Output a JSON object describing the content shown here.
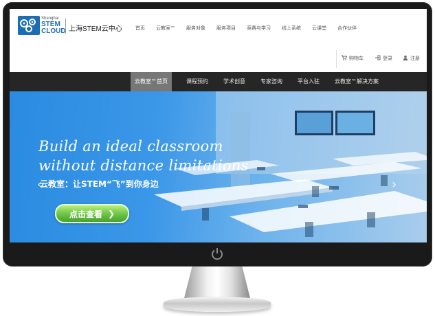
{
  "logo": {
    "city": "Shanghai",
    "brand_line1": "STEM",
    "brand_line2": "CLOUD"
  },
  "site_name": "上海STEM云中心",
  "top_nav": [
    "首页",
    "云教室™",
    "服务对象",
    "服务项目",
    "竞赛与学习",
    "线上系统",
    "云课堂",
    "合作伙伴"
  ],
  "utility": {
    "cart": "购物车",
    "login": "登录",
    "register": "注册"
  },
  "main_nav": [
    "云教室™首页",
    "课程预约",
    "学术创意",
    "专家咨询",
    "平台入驻",
    "云教室™解决方案"
  ],
  "hero": {
    "title_line1": "Build an ideal classroom",
    "title_line2": "without distance limitations",
    "subtitle": "云教室：让STEM“飞”到你身边",
    "cta_label": "点击查看"
  },
  "colors": {
    "brand_blue": "#1d6db5",
    "nav_dark": "#262626",
    "nav_active": "#777777",
    "cta_green": "#6fc64a"
  }
}
